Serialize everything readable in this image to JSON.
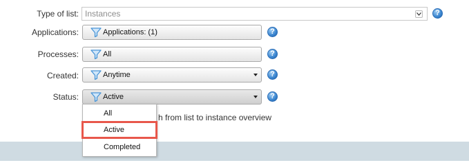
{
  "form": {
    "type_of_list": {
      "label": "Type of list:",
      "value": "Instances"
    },
    "applications": {
      "label": "Applications:",
      "value": "Applications: (1)"
    },
    "processes": {
      "label": "Processes:",
      "value": "All"
    },
    "created": {
      "label": "Created:",
      "value": "Anytime"
    },
    "status": {
      "label": "Status:",
      "value": "Active"
    },
    "help_glyph": "?"
  },
  "show_option_text": "h from list to instance overview",
  "status_dropdown": {
    "options": [
      "All",
      "Active",
      "Completed"
    ],
    "highlighted": "Active"
  },
  "colors": {
    "footer_bar": "#cfdbe2",
    "highlight_border": "#e8574b",
    "help_icon": "#3b86d0",
    "filter_icon": "#4a95d6"
  },
  "icons": [
    "filter-icon",
    "help-icon",
    "chevron-down-icon",
    "caret-down-icon"
  ]
}
